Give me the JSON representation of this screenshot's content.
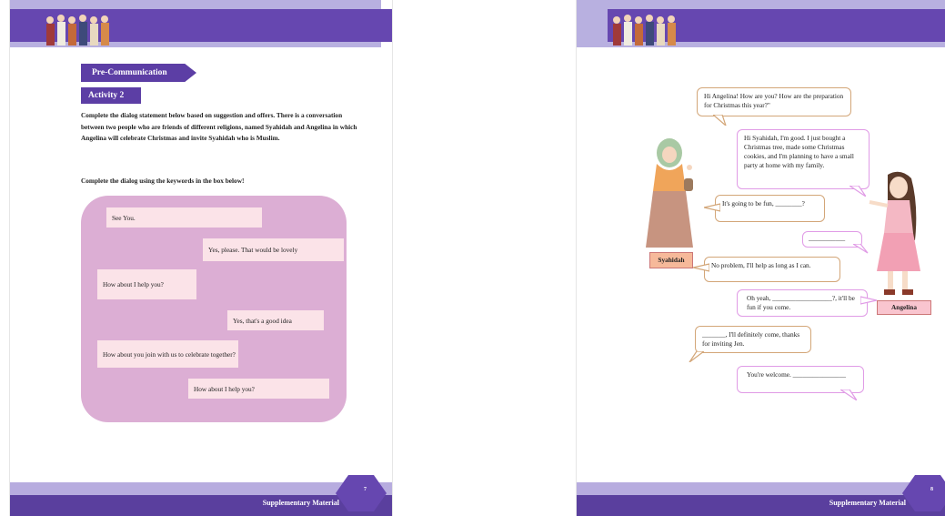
{
  "left_page": {
    "pre_communication_label": "Pre-Communication",
    "activity_label": "Activity 2",
    "instruction": "Complete the dialog statement below based on suggestion and offers.  There is a conversation between two people who are friends of different religions, named Syahidah and Angelina in which Angelina will celebrate Christmas and invite Syahidah who is Muslim.",
    "instruction2": "Complete the dialog using the keywords in the box below!",
    "keywords": [
      "See You.",
      "Yes, please. That would be lovely",
      "How about I help you?",
      "Yes, that's a good idea",
      "How about you join with us to celebrate together?",
      "How about I help you?"
    ],
    "footer_label": "Supplementary Material",
    "page_number": "7"
  },
  "right_page": {
    "dialog": [
      "Hi Angelina! How are you? How are the preparation for Christmas this year?\"",
      "Hi Syahidah, I'm good. I just bought a Christmas tree, made some Christmas cookies, and I'm planning to have a small party at home with my family.",
      "It's going to be fun, ________?",
      "___________",
      "No problem, I'll help as long as I can.",
      "Oh yeah, __________________?, it'll be fun if you come.",
      "_______, I'll definitely come, thanks for inviting Jen.",
      "You're welcome. ________________"
    ],
    "name_left": "Syahidah",
    "name_right": "Angelina",
    "footer_label": "Supplementary Material",
    "page_number": "8"
  },
  "colors": {
    "header_dark": "#6647b0",
    "header_light": "#b8b0e0",
    "tag": "#5c3ea5",
    "keyword_box": "#dcaed4",
    "keyword_item": "#fbe3e8",
    "bubble_tan": "#d3a678",
    "bubble_pink": "#e09be6"
  },
  "icons": [
    "people-group-illustration",
    "girl-hijab-illustration",
    "girl-pink-dress-illustration"
  ]
}
